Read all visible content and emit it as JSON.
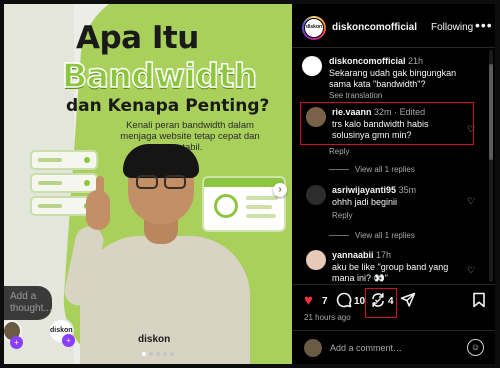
{
  "post_image": {
    "headline_line1": "Apa Itu",
    "headline_line2": "Bandwidth",
    "headline_line3": "dan Kenapa Penting?",
    "subtext": "Kenali peran bandwidth dalam menjaga website tetap cepat dan stabil.",
    "brand": "diskon",
    "next_glyph": "›"
  },
  "overlay": {
    "thought_placeholder": "Add a thought..."
  },
  "header": {
    "avatar_text": "diskon",
    "username": "diskoncomofficial",
    "following_label": "Following",
    "more_glyph": "•••"
  },
  "comments": [
    {
      "username": "diskoncomofficial",
      "time": "21h",
      "text": "Sekarang udah gak bingungkan sama kata \"bandwidth\"?",
      "action": "See translation"
    },
    {
      "username": "rie.vaann",
      "time": "32m",
      "edited": "Edited",
      "text": "trs kalo bandwidth habis solusinya gmn min?",
      "reply": "Reply",
      "view_replies": "View all 1 replies"
    },
    {
      "username": "asriwijayanti95",
      "time": "35m",
      "text": "ohhh jadi beginii",
      "reply": "Reply",
      "view_replies": "View all 1 replies"
    },
    {
      "username": "yannaabii",
      "time": "17h",
      "text": "aku be like \"group band yang mana ini? 👀\""
    }
  ],
  "actions": {
    "likes": "7",
    "comments": "10",
    "reposts": "4",
    "time_ago": "21 hours ago"
  },
  "add_comment": {
    "placeholder": "Add a comment…"
  },
  "colors": {
    "like_red": "#ff3040",
    "brand_green": "#8cc63f",
    "highlight_red": "#d10f1f"
  },
  "icons": {
    "like": "heart-filled-icon",
    "comment": "comment-bubble-icon",
    "repost": "repost-icon",
    "share": "send-icon",
    "save": "bookmark-icon",
    "emoji": "emoji-icon"
  }
}
